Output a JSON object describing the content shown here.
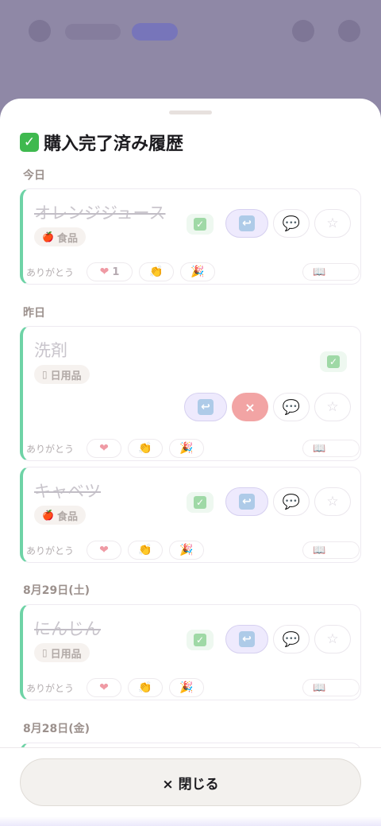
{
  "sheet": {
    "title": "購入完了済み履歴",
    "title_icon": "check-box-icon",
    "close_label": "× 閉じる"
  },
  "groups": [
    {
      "date": "今日",
      "items": [
        {
          "name": "オレンジジュース",
          "category": "食品",
          "category_icon": "apple-icon",
          "strikethrough": true,
          "heart_count": "1"
        },
        {
          "name": "洗剤",
          "category": "日用品",
          "category_icon": "roll-icon",
          "strikethrough": false,
          "delete_visible": true
        },
        {
          "name": "キャベツ",
          "category": "食品",
          "category_icon": "apple-icon",
          "strikethrough": true
        }
      ]
    },
    {
      "date": "昨日"
    },
    {
      "date": "8月29日(土)",
      "items": [
        {
          "name": "にんじん",
          "category": "日用品",
          "category_icon": "roll-icon",
          "strikethrough": true
        }
      ]
    },
    {
      "date": "8月28日(金)"
    }
  ],
  "labels": {
    "thanks": "ありがとう",
    "delete_mark": "×"
  },
  "colors": {
    "accent_border": "#6ed3a6",
    "delete": "#f2a4a4",
    "undo_bg": "#eeeafd",
    "backdrop": "#8f88a6"
  }
}
